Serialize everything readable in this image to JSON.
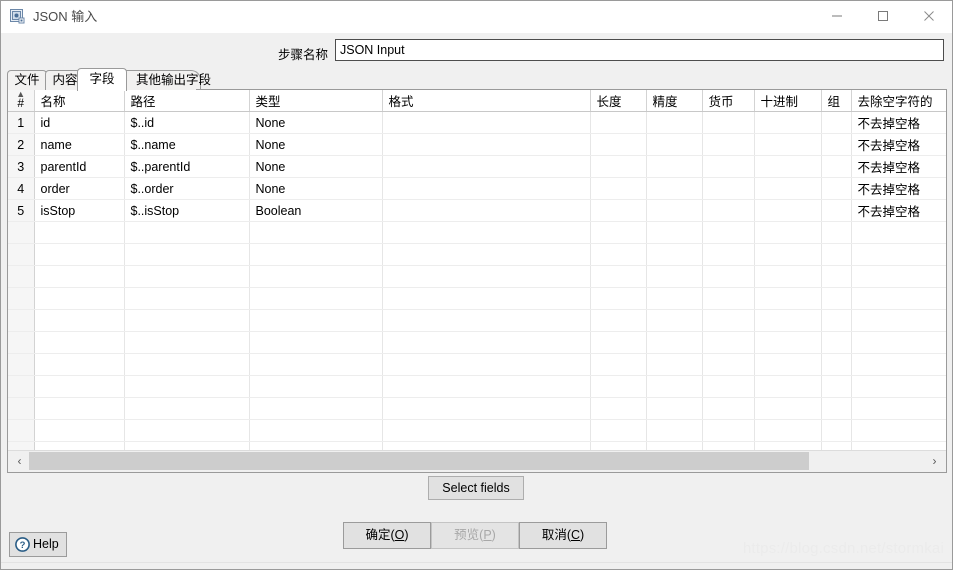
{
  "window": {
    "title": "JSON 输入",
    "icon": "json-input-app-icon",
    "controls": {
      "minimize": "minimize-icon",
      "maximize": "maximize-icon",
      "close": "close-icon"
    }
  },
  "step_name": {
    "label": "步骤名称",
    "value": "JSON Input",
    "placeholder": ""
  },
  "tabs": [
    {
      "label": "文件",
      "selected": false
    },
    {
      "label": "内容",
      "selected": false
    },
    {
      "label": "字段",
      "selected": true
    },
    {
      "label": "其他输出字段",
      "selected": false
    }
  ],
  "grid": {
    "index_header": "#",
    "sort_caret": "▲",
    "columns": [
      "名称",
      "路径",
      "类型",
      "格式",
      "长度",
      "精度",
      "货币",
      "十进制",
      "组",
      "去除空字符的"
    ],
    "rows": [
      {
        "index": "1",
        "名称": "id",
        "路径": "$..id",
        "类型": "None",
        "格式": "",
        "长度": "",
        "精度": "",
        "货币": "",
        "十进制": "",
        "组": "",
        "去除空字符的": "不去掉空格"
      },
      {
        "index": "2",
        "名称": "name",
        "路径": "$..name",
        "类型": "None",
        "格式": "",
        "长度": "",
        "精度": "",
        "货币": "",
        "十进制": "",
        "组": "",
        "去除空字符的": "不去掉空格"
      },
      {
        "index": "3",
        "名称": "parentId",
        "路径": "$..parentId",
        "类型": "None",
        "格式": "",
        "长度": "",
        "精度": "",
        "货币": "",
        "十进制": "",
        "组": "",
        "去除空字符的": "不去掉空格"
      },
      {
        "index": "4",
        "名称": "order",
        "路径": "$..order",
        "类型": "None",
        "格式": "",
        "长度": "",
        "精度": "",
        "货币": "",
        "十进制": "",
        "组": "",
        "去除空字符的": "不去掉空格"
      },
      {
        "index": "5",
        "名称": "isStop",
        "路径": "$..isStop",
        "类型": "Boolean",
        "格式": "",
        "长度": "",
        "精度": "",
        "货币": "",
        "十进制": "",
        "组": "",
        "去除空字符的": "不去掉空格"
      }
    ],
    "empty_row_count": 12
  },
  "scrollbar": {
    "left_arrow": "‹",
    "right_arrow": "›",
    "thumb_percent": "87"
  },
  "buttons": {
    "select_fields": "Select fields",
    "ok": "确定(O)",
    "ok_text": "确定(",
    "ok_mnemonic": "O",
    "preview_text": "预览(",
    "preview_mnemonic": "P",
    "cancel_text": "取消(",
    "cancel_mnemonic": "C",
    "paren_close": ")",
    "help": "Help"
  },
  "watermark": "https://blog.csdn.net/stormkai"
}
